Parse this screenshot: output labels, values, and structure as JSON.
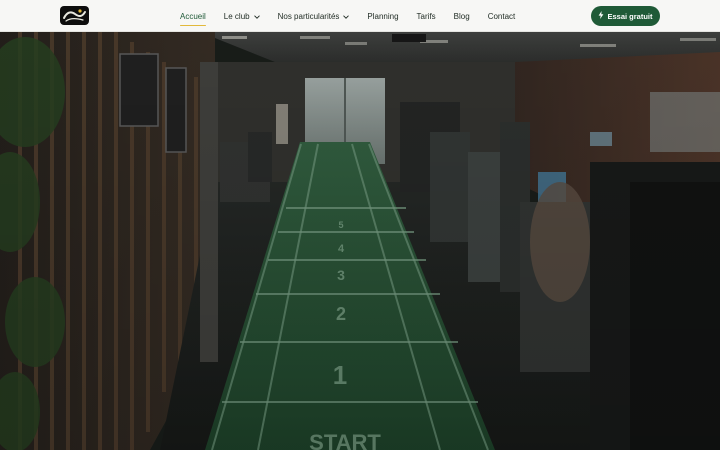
{
  "header": {
    "logo_icon": "club-logo",
    "nav": [
      {
        "label": "Accueil",
        "active": true,
        "dropdown": false
      },
      {
        "label": "Le club",
        "active": false,
        "dropdown": true
      },
      {
        "label": "Nos particularités",
        "active": false,
        "dropdown": true
      },
      {
        "label": "Planning",
        "active": false,
        "dropdown": false
      },
      {
        "label": "Tarifs",
        "active": false,
        "dropdown": false
      },
      {
        "label": "Blog",
        "active": false,
        "dropdown": false
      },
      {
        "label": "Contact",
        "active": false,
        "dropdown": false
      }
    ],
    "cta": {
      "label": "Essai gratuit",
      "icon": "lightning-bolt-icon"
    }
  },
  "hero": {
    "image": "gym-interior-photo",
    "turf_markings": [
      "1",
      "2",
      "3",
      "4",
      "5",
      "START"
    ]
  },
  "colors": {
    "brand_green": "#1f5a37",
    "active_underline": "#e2b93b",
    "header_bg": "#f7f7f5",
    "turf_green": "#2f6a3f"
  }
}
